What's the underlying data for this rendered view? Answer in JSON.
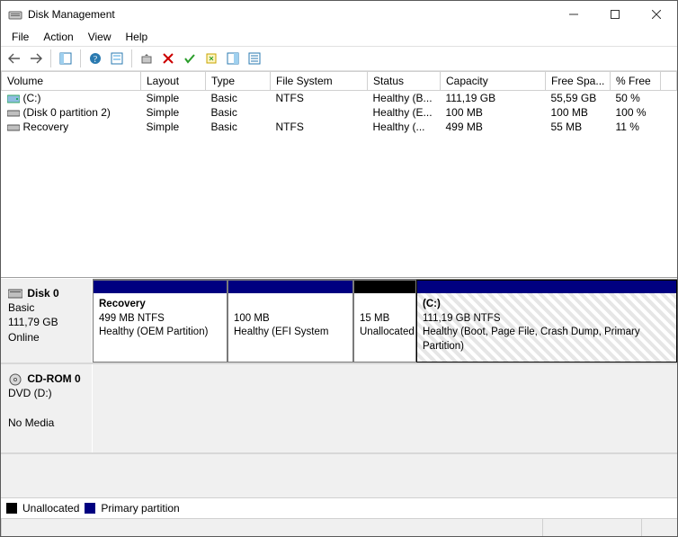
{
  "window": {
    "title": "Disk Management"
  },
  "menu": {
    "file": "File",
    "action": "Action",
    "view": "View",
    "help": "Help"
  },
  "columns": {
    "volume": "Volume",
    "layout": "Layout",
    "type": "Type",
    "filesystem": "File System",
    "status": "Status",
    "capacity": "Capacity",
    "freespace": "Free Spa...",
    "pctfree": "% Free"
  },
  "volumes": [
    {
      "name": "(C:)",
      "layout": "Simple",
      "type": "Basic",
      "fs": "NTFS",
      "status": "Healthy (B...",
      "capacity": "111,19 GB",
      "free": "55,59 GB",
      "pct": "50 %",
      "icon": "drive"
    },
    {
      "name": "(Disk 0 partition 2)",
      "layout": "Simple",
      "type": "Basic",
      "fs": "",
      "status": "Healthy (E...",
      "capacity": "100 MB",
      "free": "100 MB",
      "pct": "100 %",
      "icon": "part"
    },
    {
      "name": "Recovery",
      "layout": "Simple",
      "type": "Basic",
      "fs": "NTFS",
      "status": "Healthy (...",
      "capacity": "499 MB",
      "free": "55 MB",
      "pct": "11 %",
      "icon": "part"
    }
  ],
  "disks": {
    "disk0": {
      "title": "Disk 0",
      "type": "Basic",
      "size": "111,79 GB",
      "state": "Online"
    },
    "cdrom": {
      "title": "CD-ROM 0",
      "sub": "DVD (D:)",
      "state": "No Media"
    }
  },
  "parts": {
    "recovery": {
      "title": "Recovery",
      "line2": "499 MB NTFS",
      "line3": "Healthy (OEM Partition)"
    },
    "efi": {
      "title": "",
      "line2": "100 MB",
      "line3": "Healthy (EFI System"
    },
    "unalloc": {
      "title": "",
      "line2": "15 MB",
      "line3": "Unallocated"
    },
    "c": {
      "title": "(C:)",
      "line2": "111,19 GB NTFS",
      "line3": "Healthy (Boot, Page File, Crash Dump, Primary Partition)"
    }
  },
  "legend": {
    "unallocated": "Unallocated",
    "primary": "Primary partition"
  },
  "colors": {
    "primary_stripe": "#000080",
    "unalloc_stripe": "#000000"
  }
}
